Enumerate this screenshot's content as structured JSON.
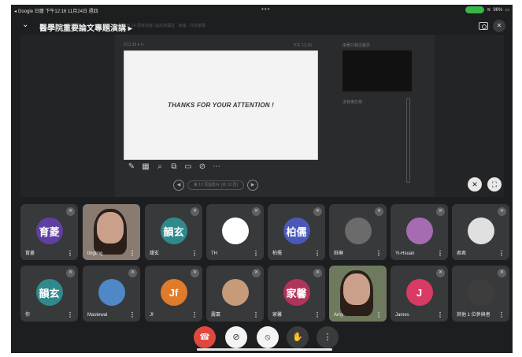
{
  "status": {
    "left": "◂ Google 日曆  下午12:16  11月24日 週四",
    "battery": "96%",
    "dots": "•••"
  },
  "header": {
    "title": "醫學院重要論文專題演講 ▸",
    "ghost": "(已有 14 個參與者) 提前演講及 · 會議 · 共享螢幕"
  },
  "presentation": {
    "slide_text": "THANKS FOR YOUR ATTENTION !",
    "meta_left": "0:11:19  ⏸  ↻",
    "meta_right": "下午 12:16",
    "next_label": "接著只剩這幾頁",
    "notes_label": "沒有備忘稿 ·",
    "nav_label": "第 12 頁投影片 (共 12 頁)"
  },
  "participants": [
    {
      "initials": "育菱",
      "name": "育菱",
      "color": "#5f3fa0",
      "muted": true
    },
    {
      "initials": "",
      "name": "tingting",
      "color": "",
      "muted": false,
      "photo": true
    },
    {
      "initials": "韻玄",
      "name": "韻玄",
      "color": "#2f8a8c",
      "muted": true
    },
    {
      "initials": "",
      "name": "TH",
      "color": "#ffffff",
      "muted": true
    },
    {
      "initials": "柏儒",
      "name": "柏儒",
      "color": "#4a58b8",
      "muted": true
    },
    {
      "initials": "",
      "name": "鈺琳",
      "color": "#6b6b6b",
      "muted": true
    },
    {
      "initials": "",
      "name": "Yi-Hsuan",
      "color": "#a66bb0",
      "muted": true
    },
    {
      "initials": "",
      "name": "君君",
      "color": "#e0e0e0",
      "muted": true
    },
    {
      "initials": "韻玄",
      "name": "你",
      "color": "#2f8a8c",
      "muted": true
    },
    {
      "initials": "",
      "name": "Mastewal",
      "color": "#4f88c6",
      "muted": true
    },
    {
      "initials": "Jf",
      "name": "Jf",
      "color": "#e07b2a",
      "muted": true
    },
    {
      "initials": "",
      "name": "震寰",
      "color": "#c79a7a",
      "muted": true
    },
    {
      "initials": "家馨",
      "name": "家馨",
      "color": "#b0345a",
      "muted": true
    },
    {
      "initials": "",
      "name": "Amy",
      "color": "",
      "muted": false,
      "photo": true
    },
    {
      "initials": "J",
      "name": "James",
      "color": "#d93a63",
      "muted": true
    },
    {
      "initials": "",
      "name": "其他 1 位參與者",
      "color": "#3d3d3d",
      "muted": true
    }
  ],
  "icons": {
    "muted": "mic-off-icon",
    "more": "more-vert-icon"
  }
}
